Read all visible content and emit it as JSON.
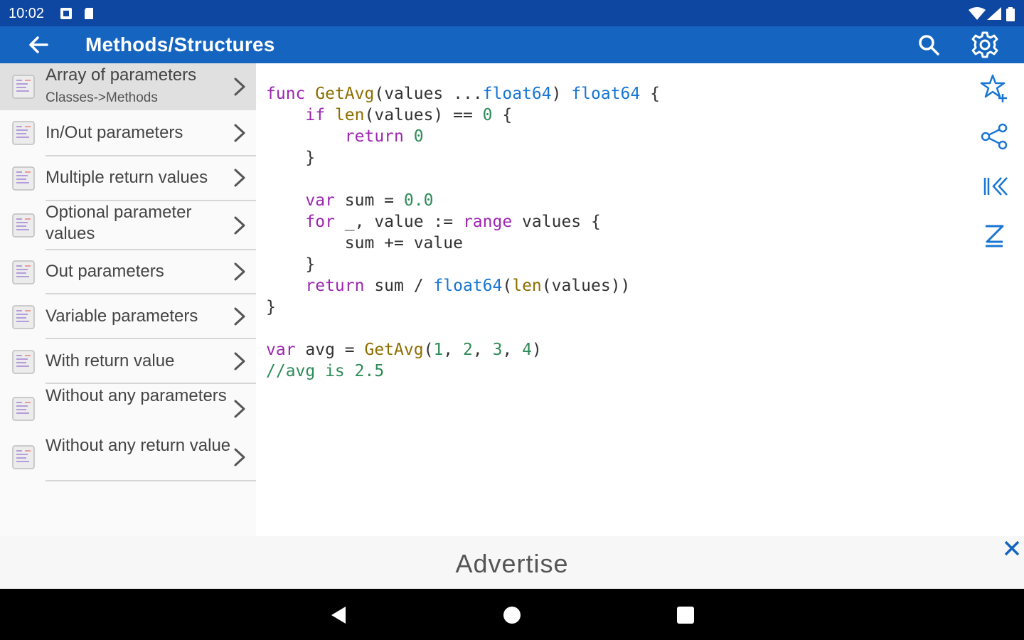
{
  "status_bar": {
    "time": "10:02"
  },
  "app_bar": {
    "title": "Methods/Structures",
    "back_icon": "arrow-left-icon",
    "search_icon": "search-icon",
    "settings_icon": "gear-icon"
  },
  "sidebar": {
    "items": [
      {
        "label": "Array of parameters",
        "subtitle": "Classes->Methods",
        "selected": true
      },
      {
        "label": "In/Out parameters"
      },
      {
        "label": "Multiple return values"
      },
      {
        "label": "Optional parameter values"
      },
      {
        "label": "Out parameters"
      },
      {
        "label": "Variable parameters"
      },
      {
        "label": "With return value"
      },
      {
        "label": "Without any parameters"
      },
      {
        "label": "Without any return value"
      }
    ]
  },
  "code": {
    "lines": [
      "func GetAvg(values ...float64) float64 {",
      "    if len(values) == 0 {",
      "        return 0",
      "    }",
      "",
      "    var sum = 0.0",
      "    for _, value := range values {",
      "        sum += value",
      "    }",
      "    return sum / float64(len(values))",
      "}",
      "",
      "var avg = GetAvg(1, 2, 3, 4)",
      "//avg is 2.5"
    ]
  },
  "tools": [
    "star-add-icon",
    "share-icon",
    "first-page-icon",
    "sum-icon"
  ],
  "ad": {
    "text": "Advertise",
    "close_icon": "close-icon"
  },
  "colors": {
    "status_bar": "#0d47a1",
    "app_bar": "#1565c0",
    "keyword": "#9c27b0",
    "type": "#1976d2",
    "function": "#8d6e00",
    "number": "#2e8b57"
  }
}
